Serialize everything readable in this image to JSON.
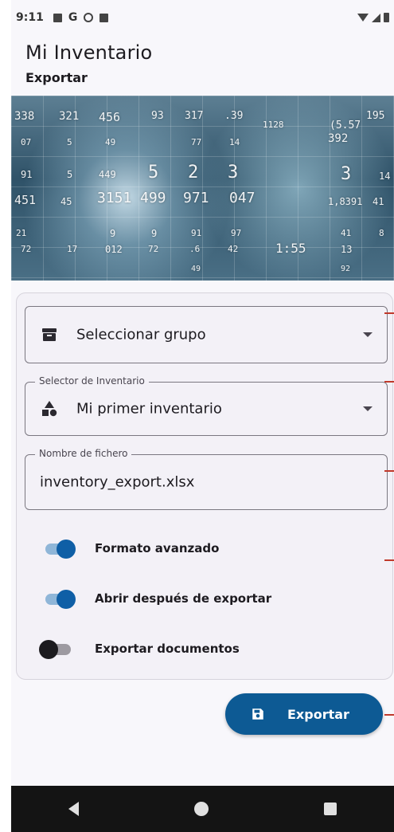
{
  "status_bar": {
    "time": "9:11"
  },
  "app_bar": {
    "title": "Mi Inventario",
    "subtitle": "Exportar"
  },
  "banner_numbers": [
    "338",
    "321",
    "456",
    "93",
    "317",
    ".39",
    "1128",
    "195",
    "07",
    "5",
    "49",
    "77",
    "14",
    "(5.57",
    "392",
    "91",
    "5",
    "449",
    "5",
    "2",
    "3",
    "3",
    "14",
    "451",
    "45",
    "3151",
    "499",
    "971",
    "047",
    "1,8391",
    "41",
    "21",
    "9",
    "9",
    "91",
    "97",
    "41",
    "8",
    "72",
    "17",
    "012",
    "72",
    ".6",
    "42",
    "1:55",
    "13",
    "49",
    "92"
  ],
  "form": {
    "group_select": {
      "value": "Seleccionar grupo",
      "icon": "archive-icon"
    },
    "inventory_select": {
      "label": "Selector de Inventario",
      "value": "Mi primer inventario",
      "icon": "shapes-icon"
    },
    "filename_field": {
      "label": "Nombre de fichero",
      "value": "inventory_export.xlsx"
    },
    "switches": [
      {
        "label": "Formato avanzado",
        "checked": true
      },
      {
        "label": "Abrir después de exportar",
        "checked": true
      },
      {
        "label": "Exportar documentos",
        "checked": false
      }
    ]
  },
  "export_button": {
    "label": "Exportar",
    "icon": "save-icon"
  },
  "colors": {
    "primary": "#0d5a94",
    "switch_on": "#0f5fa6",
    "track_on": "#8fb6d8",
    "nav_bar": "#141414"
  }
}
